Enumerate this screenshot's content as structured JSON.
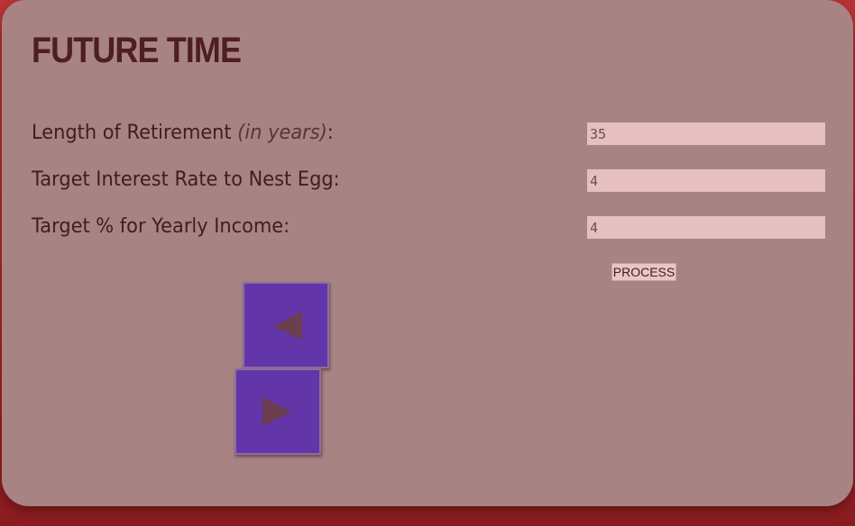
{
  "title": "FUTURE TIME",
  "form": {
    "rows": [
      {
        "label": "Length of Retirement ",
        "hint": "(in years)",
        "suffix": ":",
        "value": "35"
      },
      {
        "label": "Target Interest Rate to Nest Egg:",
        "value": "4"
      },
      {
        "label": "Target % for Yearly Income:",
        "value": "4"
      }
    ],
    "process_label": "PROCESS"
  },
  "nav": {
    "prev_icon": "triangle-left-icon",
    "next_icon": "triangle-right-icon",
    "button_color": "#6236a8",
    "arrow_color": "#6b3e50"
  },
  "colors": {
    "background": "#b83236",
    "panel": "#a88383",
    "title": "#4e1e20",
    "input_bg": "#e6c0c0"
  }
}
